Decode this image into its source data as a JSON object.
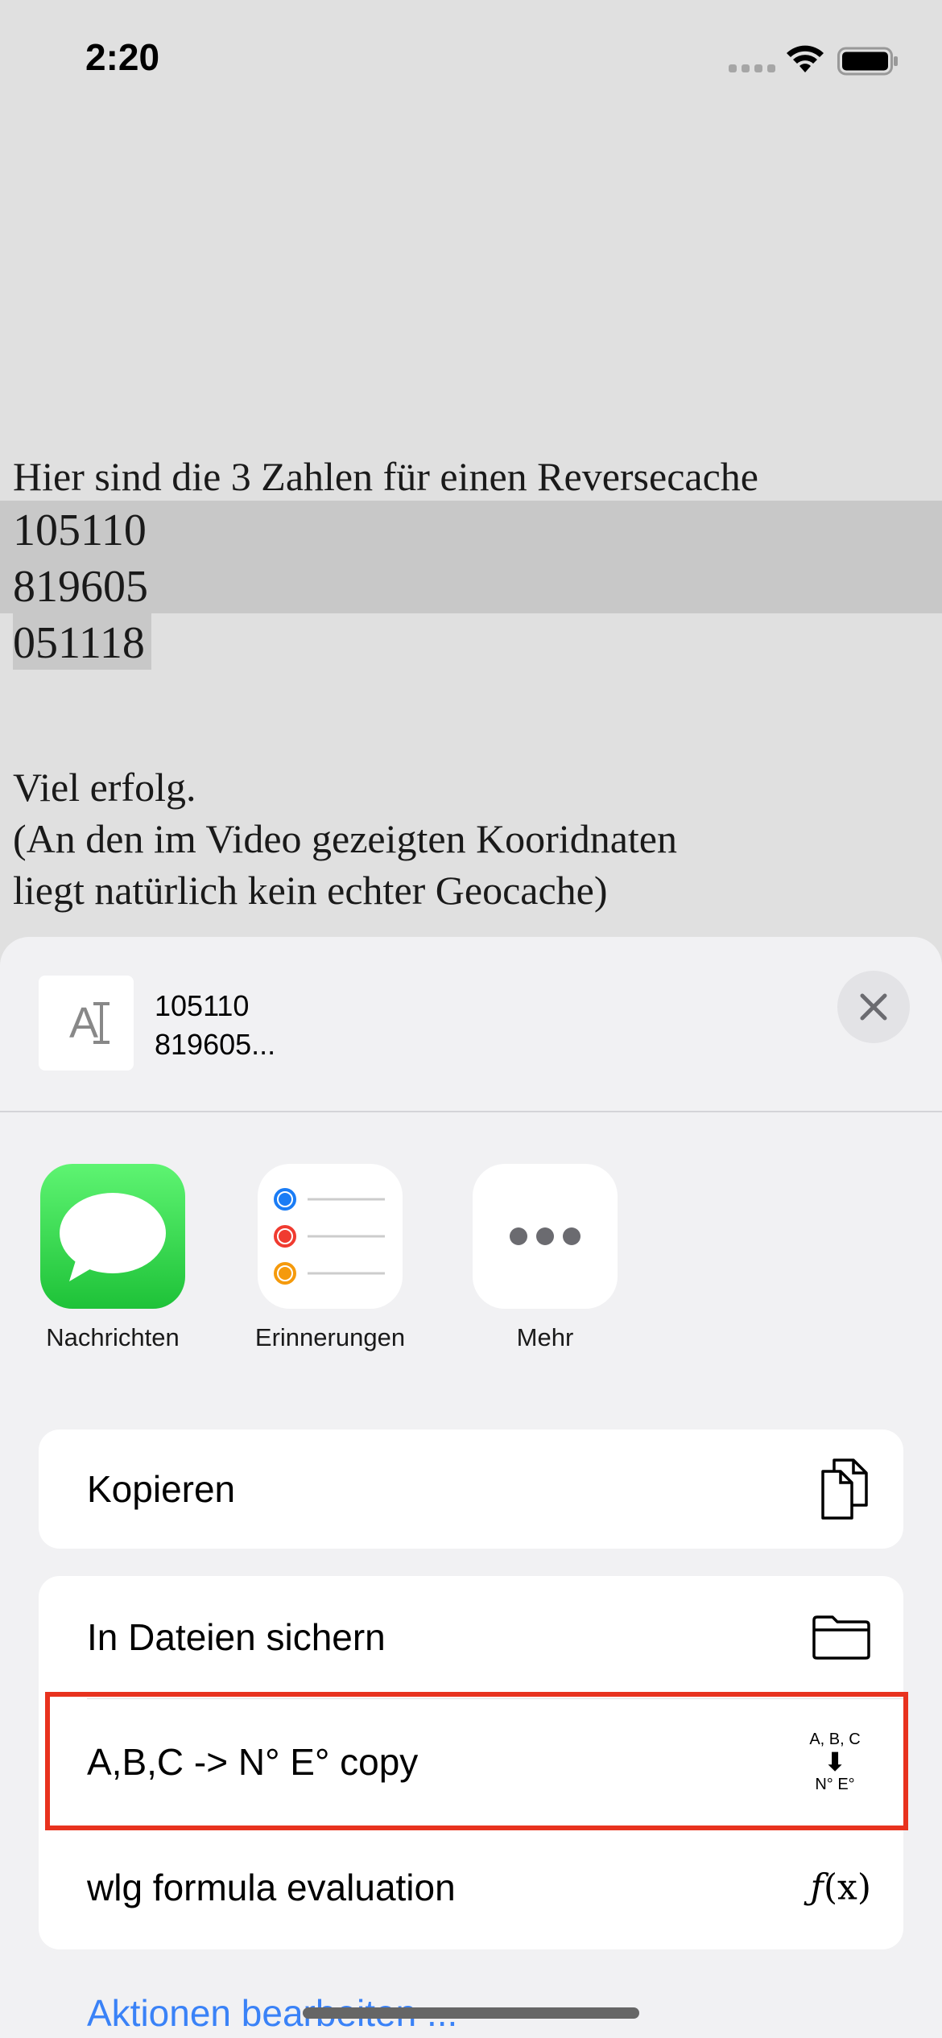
{
  "status_bar": {
    "time": "2:20"
  },
  "document": {
    "line1": "Hier sind die 3 Zahlen für einen Reversecache",
    "numbers": [
      "105110",
      "819605",
      "051118"
    ],
    "line_viel": "Viel erfolg.",
    "line_an": "(An den im Video gezeigten Kooridnaten",
    "line_liegt": "liegt natürlich kein echter Geocache)"
  },
  "share_sheet": {
    "preview_line1": "105110",
    "preview_line2": "819605...",
    "apps": [
      {
        "label": "Nachrichten",
        "icon": "messages-icon"
      },
      {
        "label": "Erinnerungen",
        "icon": "reminders-icon"
      },
      {
        "label": "Mehr",
        "icon": "more-icon"
      }
    ],
    "actions": {
      "copy": {
        "label": "Kopieren",
        "icon": "copy-icon"
      },
      "save_files": {
        "label": "In Dateien sichern",
        "icon": "folder-icon"
      },
      "abc_copy": {
        "label": "A,B,C -> N° E° copy",
        "icon_top": "A, B, C",
        "icon_bottom": "N° E°"
      },
      "formula": {
        "label": "wlg formula evaluation",
        "icon_text": "(x)",
        "icon_f": "ƒ"
      }
    },
    "edit_actions": "Aktionen bearbeiten ..."
  },
  "colors": {
    "accent": "#3a82f7",
    "highlight": "#e8321e",
    "messages_green": "#2ecc40"
  }
}
